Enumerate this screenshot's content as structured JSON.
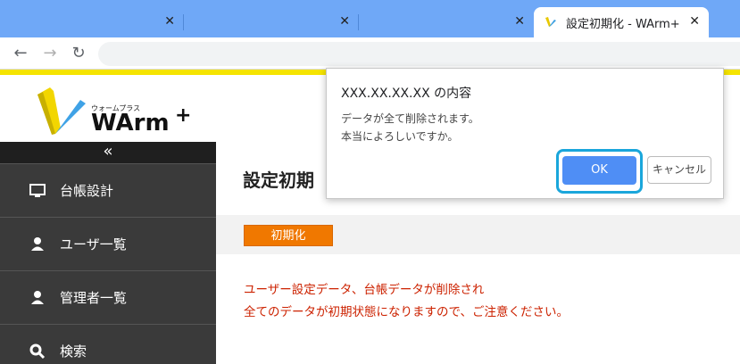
{
  "browser": {
    "tabs": [
      {
        "title": "",
        "close": "✕"
      },
      {
        "title": "",
        "close": "✕"
      },
      {
        "title": "",
        "close": "✕"
      },
      {
        "title": "設定初期化 - WArm+",
        "close": "✕"
      }
    ],
    "nav": {
      "back": "←",
      "forward": "→",
      "reload": "↻"
    }
  },
  "logo": {
    "ruby": "ウォームプラス",
    "name": "WArm",
    "plus": "+"
  },
  "sidebar": {
    "collapse": "«",
    "items": [
      {
        "label": "台帳設計",
        "icon": "monitor-icon"
      },
      {
        "label": "ユーザ一覧",
        "icon": "user-icon"
      },
      {
        "label": "管理者一覧",
        "icon": "user-icon"
      },
      {
        "label": "検索",
        "icon": "search-icon"
      }
    ]
  },
  "main": {
    "title": "設定初期",
    "badge": "初期化",
    "warning_line1": "ユーザー設定データ、台帳データが削除され",
    "warning_line2": "全てのデータが初期状態になりますので、ご注意ください。"
  },
  "dialog": {
    "title": "XXX.XX.XX.XX の内容",
    "message_line1": "データが全て削除されます。",
    "message_line2": "本当によろしいですか。",
    "ok": "OK",
    "cancel": "キャンセル"
  },
  "colors": {
    "tabstrip": "#6fa8f7",
    "accent_yellow": "#f5e400",
    "sidebar": "#3a3a3a",
    "badge_orange": "#f07800",
    "warning_red": "#cc2200",
    "ok_blue": "#4f8ef5",
    "focus_ring": "#1aa6db"
  }
}
